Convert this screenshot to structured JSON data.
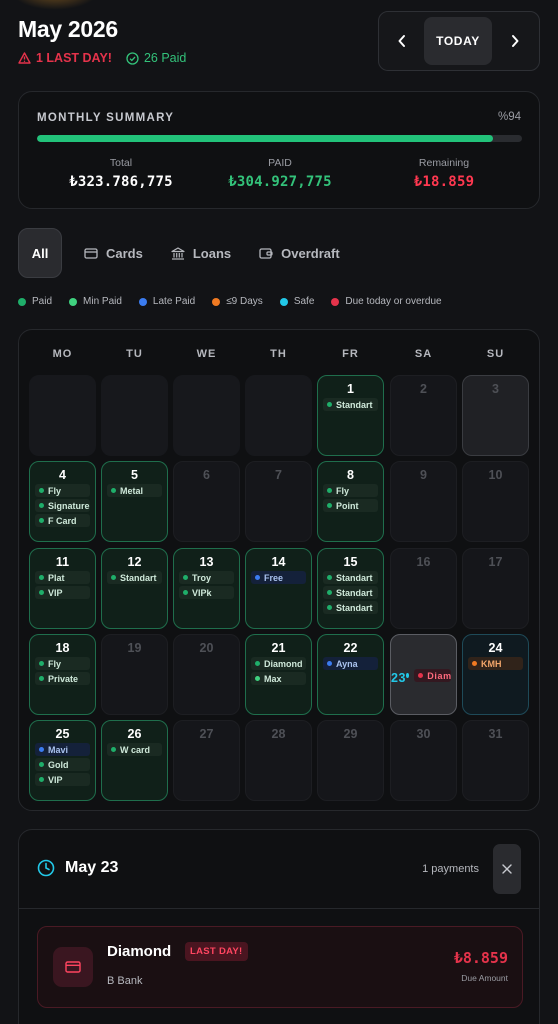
{
  "header": {
    "title": "May 2026",
    "last_day_text": "1 LAST DAY!",
    "paid_text": "26 Paid",
    "today_label": "TODAY",
    "prev_icon": "chevron-left-icon",
    "next_icon": "chevron-right-icon"
  },
  "summary": {
    "title": "MONTHLY SUMMARY",
    "percent_label": "%94",
    "progress": 0.94,
    "total_label": "Total",
    "total_value": "₺323.786,775",
    "paid_label": "PAID",
    "paid_value": "₺304.927,775",
    "remaining_label": "Remaining",
    "remaining_value": "₺18.859"
  },
  "tabs": [
    {
      "label": "All",
      "active": true
    },
    {
      "label": "Cards",
      "icon": "credit-card-icon"
    },
    {
      "label": "Loans",
      "icon": "bank-icon"
    },
    {
      "label": "Overdraft",
      "icon": "wallet-icon"
    }
  ],
  "legend": [
    {
      "label": "Paid",
      "color": "#1fae6a"
    },
    {
      "label": "Min Paid",
      "color": "#3fd27f"
    },
    {
      "label": "Late Paid",
      "color": "#3b7cf0"
    },
    {
      "label": "≤9 Days",
      "color": "#f07a22"
    },
    {
      "label": "Safe",
      "color": "#22c8e8"
    },
    {
      "label": "Due today or overdue",
      "color": "#e5334b"
    }
  ],
  "calendar": {
    "weekdays": [
      "MO",
      "TU",
      "WE",
      "TH",
      "FR",
      "SA",
      "SU"
    ],
    "weeks": [
      [
        {
          "day": "",
          "style": "empty"
        },
        {
          "day": "",
          "style": "empty"
        },
        {
          "day": "",
          "style": "empty"
        },
        {
          "day": "",
          "style": "empty"
        },
        {
          "day": "1",
          "style": "has",
          "items": [
            {
              "name": "Standart",
              "color": "#1fae6a"
            }
          ]
        },
        {
          "day": "2",
          "style": "plain"
        },
        {
          "day": "3",
          "style": "ghost"
        }
      ],
      [
        {
          "day": "4",
          "style": "has",
          "items": [
            {
              "name": "Fly",
              "color": "#1fae6a"
            },
            {
              "name": "Signature",
              "color": "#1fae6a"
            },
            {
              "name": "F Card",
              "color": "#1fae6a"
            }
          ]
        },
        {
          "day": "5",
          "style": "has",
          "items": [
            {
              "name": "Metal",
              "color": "#1fae6a"
            }
          ]
        },
        {
          "day": "6",
          "style": "plain"
        },
        {
          "day": "7",
          "style": "plain"
        },
        {
          "day": "8",
          "style": "has",
          "items": [
            {
              "name": "Fly",
              "color": "#1fae6a"
            },
            {
              "name": "Point",
              "color": "#1fae6a"
            }
          ]
        },
        {
          "day": "9",
          "style": "plain"
        },
        {
          "day": "10",
          "style": "plain"
        }
      ],
      [
        {
          "day": "11",
          "style": "has",
          "items": [
            {
              "name": "Plat",
              "color": "#1fae6a"
            },
            {
              "name": "VIP",
              "color": "#1fae6a"
            }
          ]
        },
        {
          "day": "12",
          "style": "has",
          "items": [
            {
              "name": "Standart",
              "color": "#1fae6a"
            }
          ]
        },
        {
          "day": "13",
          "style": "has",
          "items": [
            {
              "name": "Troy",
              "color": "#1fae6a"
            },
            {
              "name": "VIPk",
              "color": "#1fae6a"
            }
          ]
        },
        {
          "day": "14",
          "style": "has",
          "items": [
            {
              "name": "Free",
              "color": "#3b7cf0",
              "tone": "blue"
            }
          ]
        },
        {
          "day": "15",
          "style": "has",
          "items": [
            {
              "name": "Standart",
              "color": "#1fae6a"
            },
            {
              "name": "Standart",
              "color": "#1fae6a"
            },
            {
              "name": "Standart",
              "color": "#1fae6a"
            }
          ]
        },
        {
          "day": "16",
          "style": "plain"
        },
        {
          "day": "17",
          "style": "plain"
        }
      ],
      [
        {
          "day": "18",
          "style": "has",
          "items": [
            {
              "name": "Fly",
              "color": "#1fae6a"
            },
            {
              "name": "Private",
              "color": "#1fae6a"
            }
          ]
        },
        {
          "day": "19",
          "style": "plain"
        },
        {
          "day": "20",
          "style": "plain"
        },
        {
          "day": "21",
          "style": "has",
          "items": [
            {
              "name": "Diamond",
              "color": "#1fae6a"
            },
            {
              "name": "Max",
              "color": "#3fd27f"
            }
          ]
        },
        {
          "day": "22",
          "style": "has",
          "items": [
            {
              "name": "Ayna",
              "color": "#3b7cf0",
              "tone": "blue"
            }
          ]
        },
        {
          "day": "23",
          "style": "today",
          "items": [
            {
              "name": "Diamond",
              "color": "#e5334b",
              "tone": "red"
            }
          ]
        },
        {
          "day": "24",
          "style": "kmh",
          "items": [
            {
              "name": "KMH",
              "color": "#f07a22",
              "tone": "orange"
            }
          ]
        }
      ],
      [
        {
          "day": "25",
          "style": "has",
          "items": [
            {
              "name": "Mavi",
              "color": "#3b7cf0",
              "tone": "blue"
            },
            {
              "name": "Gold",
              "color": "#1fae6a"
            },
            {
              "name": "VIP",
              "color": "#1fae6a"
            }
          ]
        },
        {
          "day": "26",
          "style": "has",
          "items": [
            {
              "name": "W card",
              "color": "#1fae6a"
            }
          ]
        },
        {
          "day": "27",
          "style": "plain"
        },
        {
          "day": "28",
          "style": "plain"
        },
        {
          "day": "29",
          "style": "plain"
        },
        {
          "day": "30",
          "style": "plain"
        },
        {
          "day": "31",
          "style": "plain"
        }
      ]
    ]
  },
  "detail": {
    "date": "May 23",
    "count": "1 payments",
    "close_icon": "close-icon",
    "payment": {
      "name": "Diamond",
      "badge": "LAST DAY!",
      "bank": "B Bank",
      "amount": "₺8.859",
      "amount_label": "Due Amount",
      "icon": "credit-card-icon"
    }
  }
}
